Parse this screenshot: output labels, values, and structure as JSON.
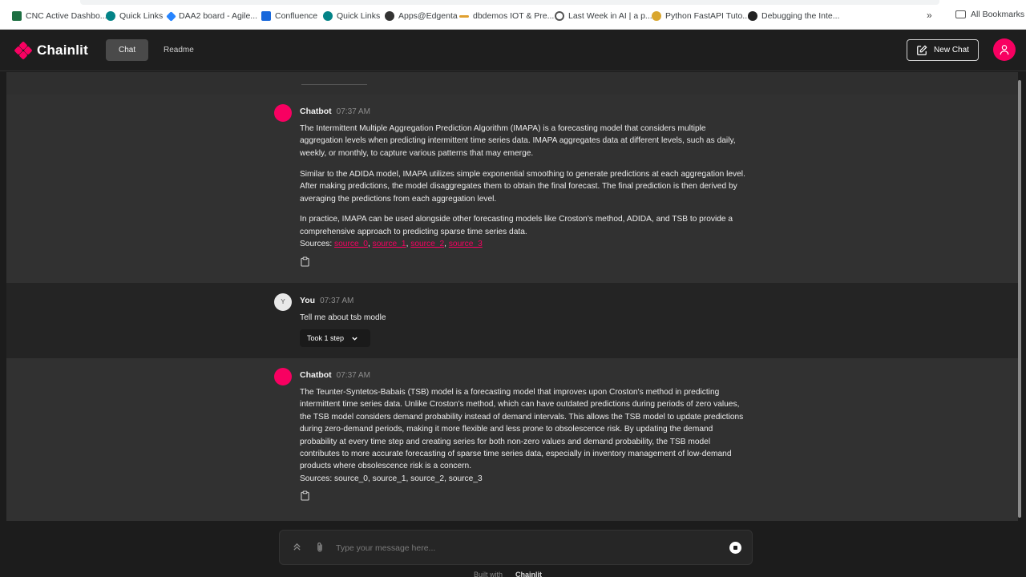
{
  "bookmarks": {
    "items": [
      {
        "label": "CNC Active Dashbo...",
        "icon": "excel-icon",
        "color": "#1d6f42"
      },
      {
        "label": "Quick Links",
        "icon": "sharepoint-icon",
        "color": "#038387"
      },
      {
        "label": "DAA2 board - Agile...",
        "icon": "jira-icon",
        "color": "#2684ff"
      },
      {
        "label": "Confluence",
        "icon": "confluence-icon",
        "color": "#1868db"
      },
      {
        "label": "Quick Links",
        "icon": "sharepoint-icon",
        "color": "#038387"
      },
      {
        "label": "Apps@Edgenta",
        "icon": "globe-icon",
        "color": "#333333"
      },
      {
        "label": "dbdemos IOT & Pre...",
        "icon": "databricks-icon",
        "color": "#e0a030"
      },
      {
        "label": "Last Week in AI | a p...",
        "icon": "podcast-icon",
        "color": "#555555"
      },
      {
        "label": "Python FastAPI Tuto...",
        "icon": "python-icon",
        "color": "#d9a62e"
      },
      {
        "label": "Debugging the Inte...",
        "icon": "hex-icon",
        "color": "#222222"
      }
    ],
    "more": "»",
    "all_bookmarks": "All Bookmarks"
  },
  "header": {
    "app_name": "Chainlit",
    "tabs": [
      {
        "label": "Chat",
        "active": true
      },
      {
        "label": "Readme",
        "active": false
      }
    ],
    "new_chat_label": "New Chat",
    "accent": "#f80061"
  },
  "messages": [
    {
      "author": "Chatbot",
      "time": "07:37 AM",
      "paragraphs": [
        "The Intermittent Multiple Aggregation Prediction Algorithm (IMAPA) is a forecasting model that considers multiple aggregation levels when predicting intermittent time series data. IMAPA aggregates data at different levels, such as daily, weekly, or monthly, to capture various patterns that may emerge.",
        "Similar to the ADIDA model, IMAPA utilizes simple exponential smoothing to generate predictions at each aggregation level. After making predictions, the model disaggregates them to obtain the final forecast. The final prediction is then derived by averaging the predictions from each aggregation level.",
        "In practice, IMAPA can be used alongside other forecasting models like Croston's method, ADIDA, and TSB to provide a comprehensive approach to predicting sparse time series data."
      ],
      "sources_label": "Sources:",
      "sources": [
        "source_0",
        "source_1",
        "source_2",
        "source_3"
      ]
    },
    {
      "author": "You",
      "avatar_letter": "Y",
      "time": "07:37 AM",
      "text": "Tell me about tsb modle",
      "step_label": "Took 1 step"
    },
    {
      "author": "Chatbot",
      "time": "07:37 AM",
      "paragraphs": [
        "The Teunter-Syntetos-Babais (TSB) model is a forecasting model that improves upon Croston's method in predicting intermittent time series data. Unlike Croston's method, which can have outdated predictions during periods of zero values, the TSB model considers demand probability instead of demand intervals. This allows the TSB model to update predictions during zero-demand periods, making it more flexible and less prone to obsolescence risk. By updating the demand probability at every time step and creating series for both non-zero values and demand probability, the TSB model contributes to more accurate forecasting of sparse time series data, especially in inventory management of low-demand products where obsolescence risk is a concern."
      ],
      "sources_text": "Sources: source_0, source_1, source_2, source_3"
    }
  ],
  "composer": {
    "placeholder": "Type your message here..."
  },
  "footer": {
    "built_with": "Built with",
    "brand": "Chainlit"
  }
}
